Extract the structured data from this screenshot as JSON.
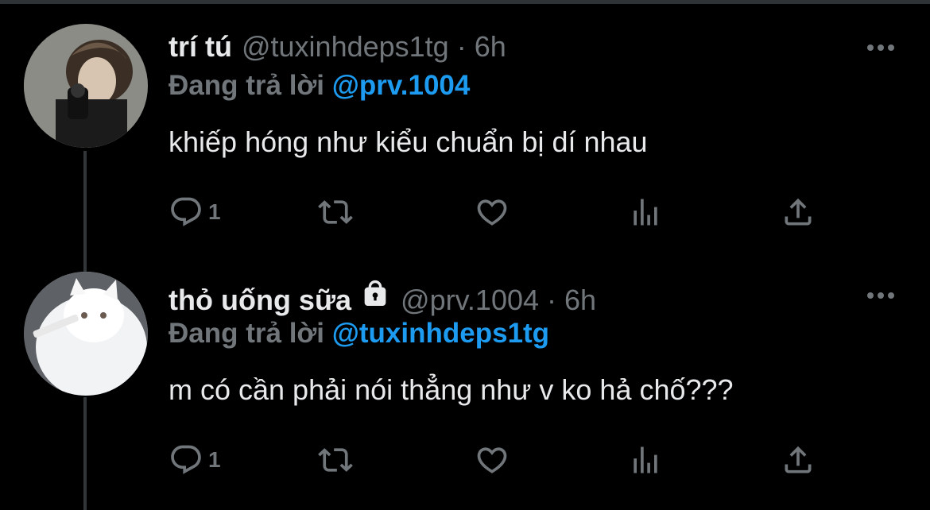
{
  "tweets": [
    {
      "name": "trí tú",
      "handle": "@tuxinhdeps1tg",
      "separator": "·",
      "time": "6h",
      "replying_prefix": "Đang trả lời",
      "replying_to": "@prv.1004",
      "text": "khiếp hóng như kiểu chuẩn bị dí nhau",
      "reply_count": "1",
      "locked": false
    },
    {
      "name": "thỏ uống sữa",
      "handle": "@prv.1004",
      "separator": "·",
      "time": "6h",
      "replying_prefix": "Đang trả lời",
      "replying_to": "@tuxinhdeps1tg",
      "text": "m có cần phải nói thẳng như v ko hả chố???",
      "reply_count": "1",
      "locked": true
    }
  ],
  "icons": {
    "more": "more-horizontal-icon",
    "reply": "reply-bubble-icon",
    "retweet": "retweet-icon",
    "like": "heart-icon",
    "views": "analytics-icon",
    "share": "share-icon",
    "lock": "lock-icon"
  },
  "colors": {
    "background": "#000000",
    "text": "#e7e9ea",
    "muted": "#71767b",
    "mention": "#1d9bf0",
    "thread_line": "#333639"
  }
}
